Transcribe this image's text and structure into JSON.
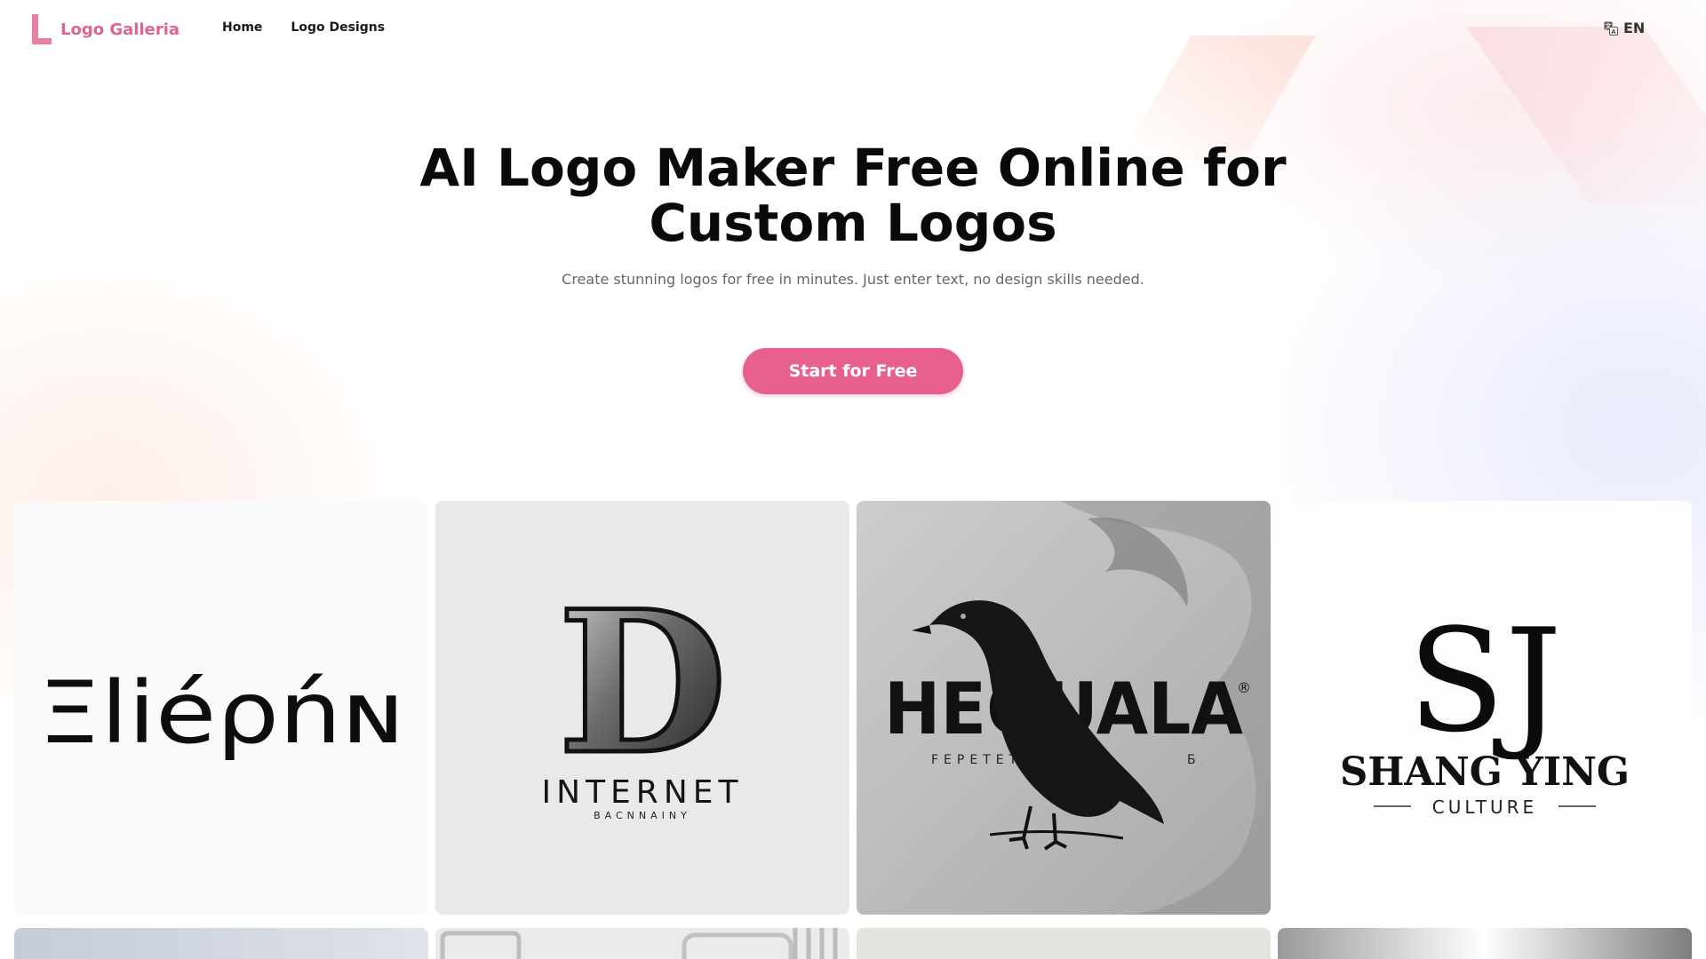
{
  "brand": {
    "name": "Logo Galleria",
    "color": "#e06490"
  },
  "nav": {
    "home": "Home",
    "logo_designs": "Logo Designs"
  },
  "language": {
    "label": "EN",
    "icon": "translate-icon"
  },
  "hero": {
    "title": "AI Logo Maker Free Online for Custom Logos",
    "subtitle": "Create stunning logos for free in minutes. Just enter text, no design skills needed.",
    "cta_label": "Start for Free",
    "cta_color": "#e8608c"
  },
  "gallery": {
    "cards": [
      {
        "wordmark": "Ξliéρńɴ",
        "tagline": ""
      },
      {
        "letter": "D",
        "wordmark": "INTERNET",
        "tagline": "BACNNAINY"
      },
      {
        "wordmark": "HEQUALA",
        "mark": "®",
        "tagline": "FEPETETE",
        "tagline_end": "Б"
      },
      {
        "monogram": "SJ",
        "wordmark": "SHANG YING",
        "tagline": "CULTURE"
      }
    ]
  }
}
